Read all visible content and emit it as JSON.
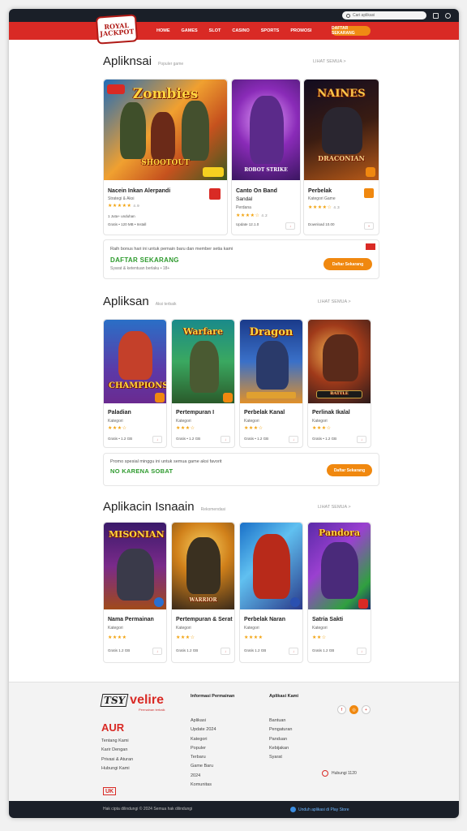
{
  "topbar": {
    "search_placeholder": "Cari aplikasi",
    "icons": [
      "bag-icon",
      "user-icon"
    ]
  },
  "brand": {
    "logo_text": "ROYAL JACKPOT"
  },
  "nav": {
    "items": [
      "HOME",
      "GAMES",
      "SLOT",
      "CASINO",
      "SPORTS",
      "PROMOSI"
    ],
    "cta": "DAFTAR SEKARANG"
  },
  "sections": [
    {
      "title": "Apliknsai",
      "subtitle": "Populer game",
      "more": "LIHAT SEMUA >",
      "cards": [
        {
          "art_title": "Zombies",
          "art_sub": "SHOOTOUT",
          "name": "Nacein Inkan Alerpandi",
          "line": "Strategi & Aksi",
          "stars": "★★★★★",
          "rating": "4.9",
          "info1": "1 Juta+ unduhan",
          "info2": "Gratis • 120 MB • Install"
        },
        {
          "art_title": "",
          "art_sub": "ROBOT STRIKE",
          "name": "Canto On Band",
          "line": "Sandal",
          "extra": "Perdana",
          "stars": "★★★★☆",
          "rating": "4.2",
          "info1": "Update 12.1.0"
        },
        {
          "art_title": "NAINES",
          "art_sub": "DRACONIAN",
          "name": "Perbelak",
          "line": "Kategori Game",
          "stars": "★★★★☆",
          "rating": "4.3",
          "info1": "Download 10.00"
        }
      ],
      "banner": {
        "line1": "Raih bonus hari ini untuk pemain baru dan member setia kami",
        "headline": "DAFTAR SEKARANG",
        "line3": "Syarat & ketentuan berlaku • 18+",
        "button": "Daftar Sekarang"
      }
    },
    {
      "title": "Apliksan",
      "subtitle": "Aksi terbaik",
      "more": "LIHAT SEMUA >",
      "cards": [
        {
          "art_title": "",
          "art_sub": "CHAMPIONS",
          "name": "Paladian",
          "line": "Kategori",
          "stars": "★★★☆",
          "info1": "Gratis • 1.2 GB"
        },
        {
          "art_title": "Warfare",
          "art_sub": "",
          "name": "Pertempuran I",
          "line": "Kategori",
          "stars": "★★★☆",
          "info1": "Gratis • 1.2 GB"
        },
        {
          "art_title": "Dragon",
          "art_sub": "",
          "name": "Perbelak Kanal",
          "line": "Kategori",
          "stars": "★★★☆",
          "info1": "Gratis • 1.2 GB"
        },
        {
          "art_title": "",
          "art_sub": "BATTLE",
          "name": "Perlinak Ikalal",
          "line": "Kategori",
          "stars": "★★★☆",
          "info1": "Gratis • 1.2 GB"
        }
      ],
      "banner": {
        "line1": "Promo spesial minggu ini untuk semua game aksi favorit",
        "headline": "NO KARENA SOBAT",
        "button": "Daftar Sekarang"
      }
    },
    {
      "title": "Aplikacin Isnaain",
      "subtitle": "Rekomendasi",
      "more": "LIHAT SEMUA >",
      "cards": [
        {
          "art_title": "MISONIAN",
          "art_sub": "",
          "name": "Nama Permainan",
          "line": "Kategori",
          "stars": "★★★★",
          "info1": "Gratis 1.2 GB"
        },
        {
          "art_title": "",
          "art_sub": "WARRIOR",
          "name": "Pertempuran & Serat",
          "line": "Kategori",
          "stars": "★★★☆",
          "info1": "Gratis 1.2 GB"
        },
        {
          "art_title": "",
          "art_sub": "",
          "name": "Perbelak Naran",
          "line": "Kategori",
          "stars": "★★★★",
          "info1": "Gratis 1.2 GB"
        },
        {
          "art_title": "Pandora",
          "art_sub": "",
          "name": "Satria Sakti",
          "line": "Kategori",
          "stars": "★★☆",
          "info1": "Gratis 1.2 GB"
        }
      ]
    }
  ],
  "footer": {
    "logo_word": "velire",
    "logo_mark": "TSY",
    "logo_sub": "Permainan terbaik",
    "aur": "AUR",
    "about": [
      "Tentang Kami",
      "Karir Dengan",
      "Privasi & Aturan",
      "Hubungi Kami"
    ],
    "col2_title": "Informasi Permainan",
    "col2": [
      "Aplikasi",
      "Update 2024",
      "Kategori",
      "Populer",
      "Terbaru",
      "Game Baru",
      "2024",
      "Komunitas"
    ],
    "col3_title": "Aplikasi Kami",
    "col3": [
      "Bantuan",
      "Pengaturan",
      "Panduan",
      "Kebijakan",
      "Syarat"
    ],
    "red_label": "UK",
    "contact": "Hubungi 1120",
    "social_icons": [
      "facebook-icon",
      "instagram-icon",
      "plus-icon"
    ]
  },
  "bottombar": {
    "copyright": "Hak cipta dilindungi © 2024 Semua hak dilindungi",
    "app_label": "Unduh aplikasi di Play Store"
  },
  "colors": {
    "brand_red": "#d92a25",
    "accent_orange": "#f0880f",
    "dark": "#1a1f28",
    "star": "#f2a20c"
  }
}
